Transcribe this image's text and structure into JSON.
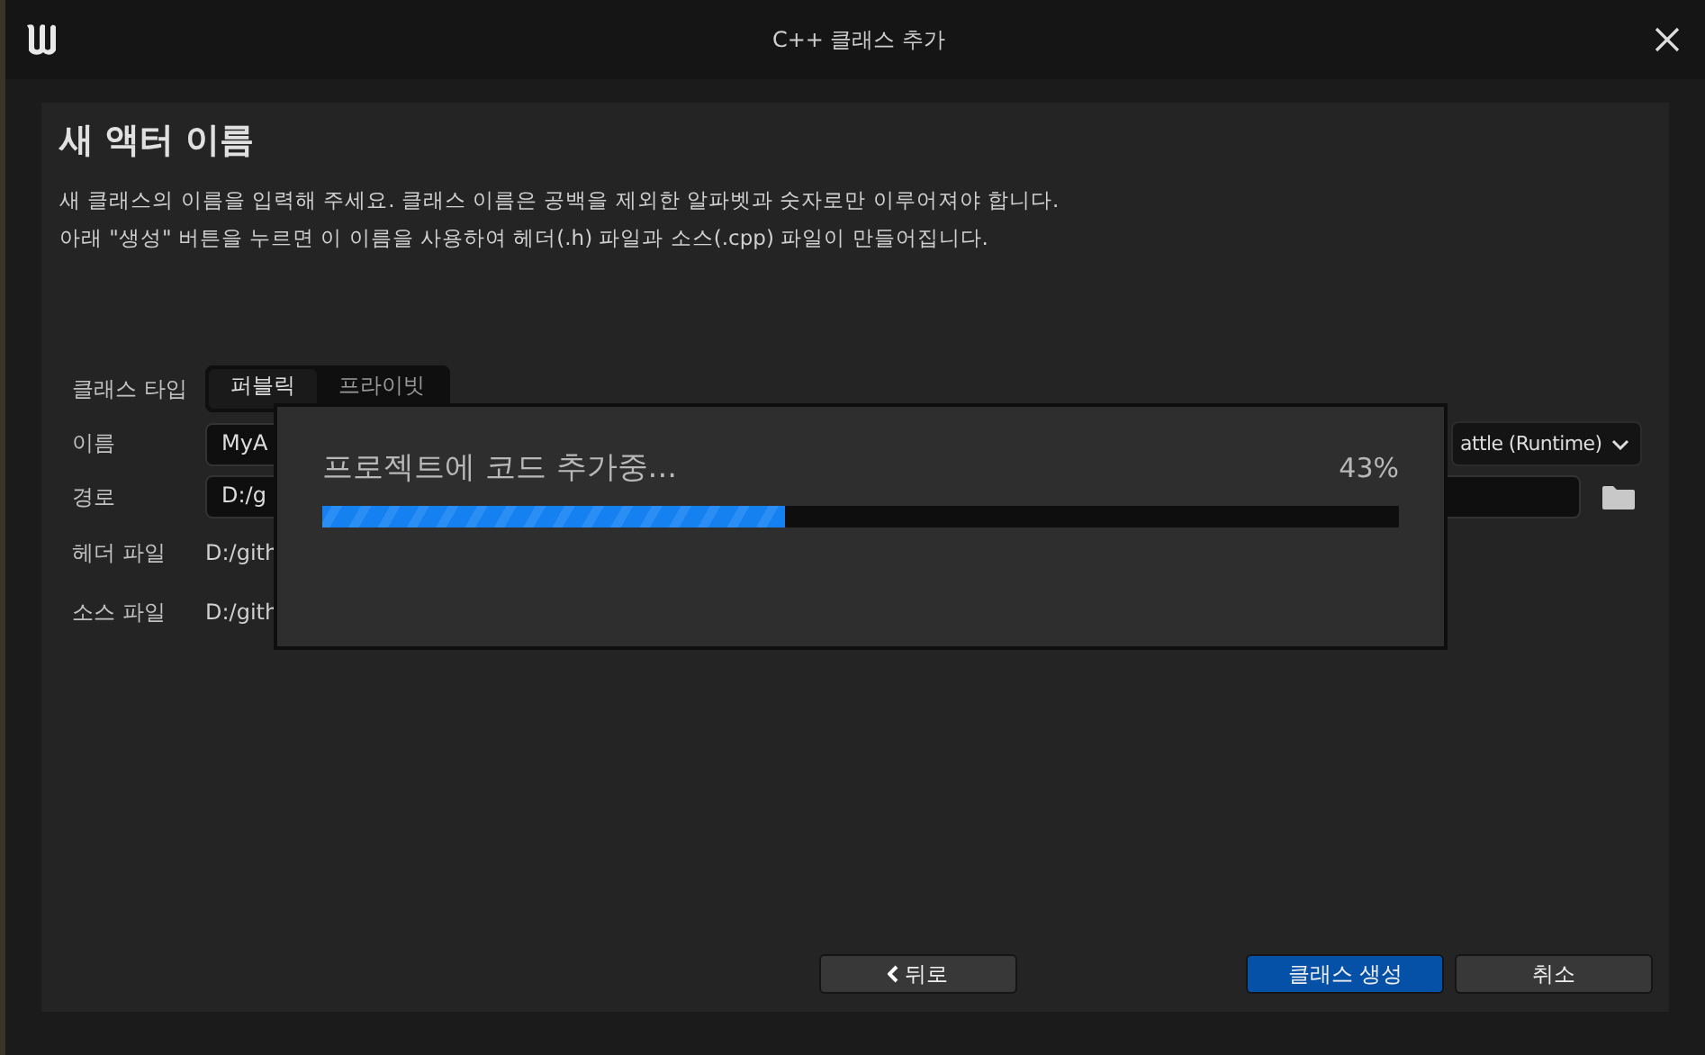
{
  "window": {
    "title": "C++ 클래스 추가"
  },
  "heading": "새 액터 이름",
  "description": [
    "새 클래스의 이름을 입력해 주세요. 클래스 이름은 공백을 제외한 알파벳과 숫자로만 이루어져야 합니다.",
    "아래 \"생성\" 버튼을 누르면 이 이름을 사용하여 헤더(.h) 파일과 소스(.cpp) 파일이 만들어집니다."
  ],
  "form": {
    "class_type": {
      "label": "클래스 타입",
      "options": [
        {
          "label": "퍼블릭",
          "selected": true
        },
        {
          "label": "프라이빗",
          "selected": false
        }
      ]
    },
    "name": {
      "label": "이름",
      "value": "MyA",
      "module": "attle (Runtime)"
    },
    "path": {
      "label": "경로",
      "value": "D:/g"
    },
    "header_file": {
      "label": "헤더 파일",
      "value": "D:/gith"
    },
    "source_file": {
      "label": "소스 파일",
      "value": "D:/gith"
    }
  },
  "progress": {
    "message": "프로젝트에 코드 추가중...",
    "percent": "43%",
    "level": 0.43
  },
  "buttons": [
    {
      "label": "뒤로",
      "kind": "back"
    },
    {
      "label": "클래스 생성",
      "kind": "primary"
    },
    {
      "label": "취소",
      "kind": "normal"
    }
  ]
}
